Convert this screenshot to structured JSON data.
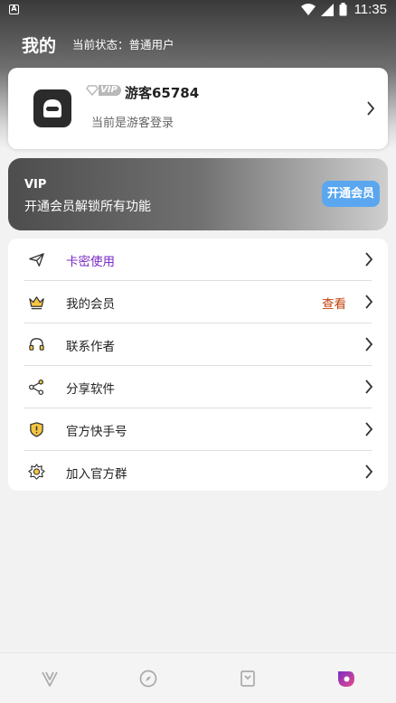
{
  "status_bar": {
    "time": "11:35",
    "notification_glyph": "A"
  },
  "header": {
    "title": "我的",
    "status_text": "当前状态：普通用户"
  },
  "profile": {
    "vip_badge": "VIP",
    "username": "游客65784",
    "login_status": "当前是游客登录"
  },
  "vip_banner": {
    "title": "VIP",
    "description": "开通会员解锁所有功能",
    "button": "开通会员"
  },
  "menu": {
    "items": [
      {
        "label": "卡密使用",
        "icon": "paper-plane-icon"
      },
      {
        "label": "我的会员",
        "icon": "crown-icon",
        "value": "查看"
      },
      {
        "label": "联系作者",
        "icon": "headset-icon"
      },
      {
        "label": "分享软件",
        "icon": "share-icon"
      },
      {
        "label": "官方快手号",
        "icon": "shield-icon"
      },
      {
        "label": "加入官方群",
        "icon": "sun-badge-icon"
      }
    ]
  },
  "tabbar": {
    "tabs": [
      "home-tab-icon",
      "discover-tab-icon",
      "bookmark-tab-icon",
      "profile-tab-icon"
    ],
    "active": 3
  },
  "colors": {
    "accent_purple": "#7a2cc4",
    "view_orange": "#c2410c",
    "vip_button": "#5aa7f0"
  }
}
